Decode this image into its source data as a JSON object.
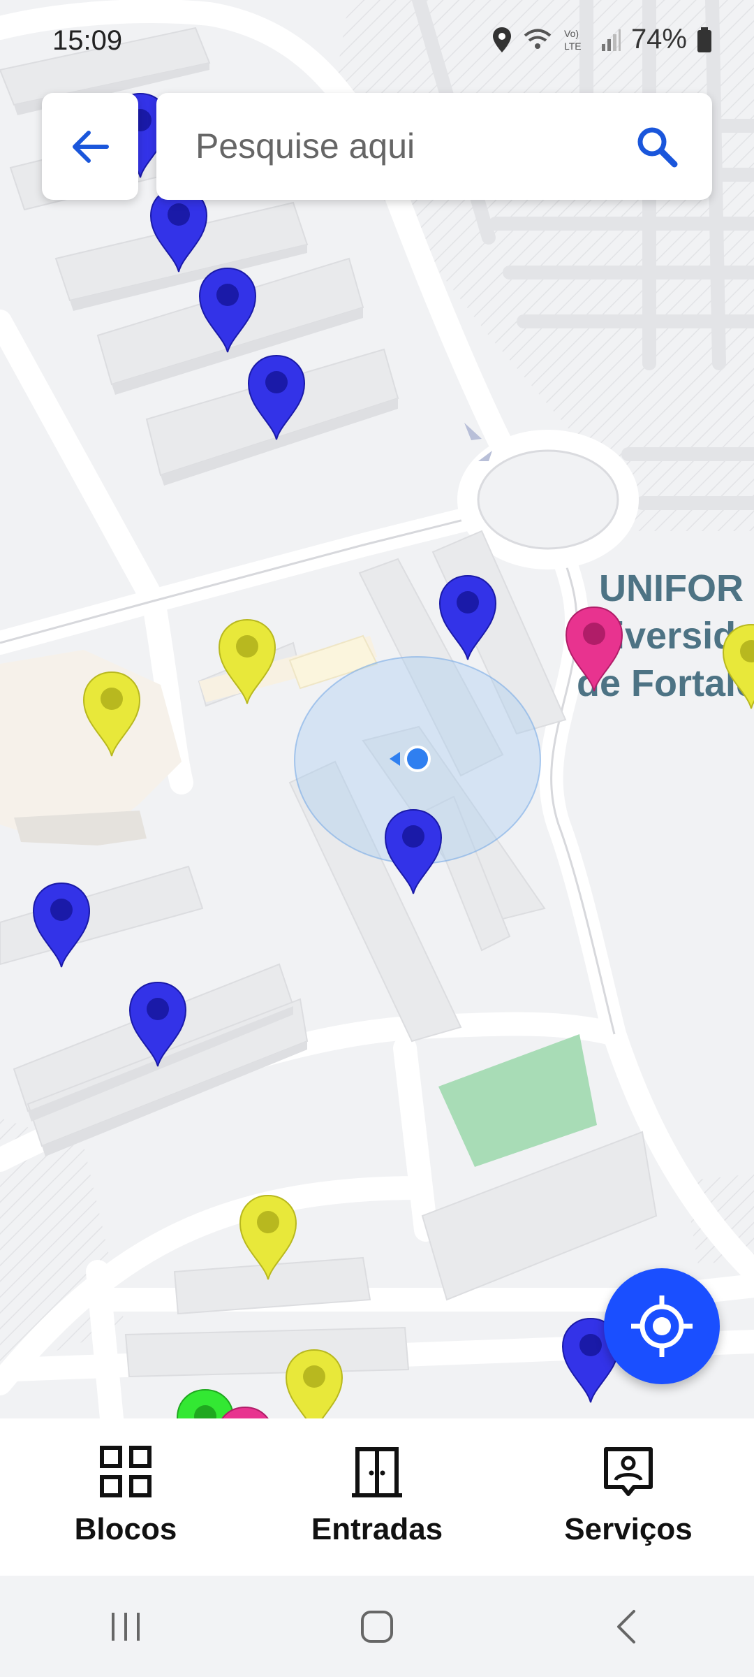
{
  "status_bar": {
    "time": "15:09",
    "battery": "74%",
    "icons": [
      "location-icon",
      "wifi-icon",
      "volte-icon",
      "signal-icon",
      "battery-icon"
    ]
  },
  "search": {
    "placeholder": "Pesquise aqui"
  },
  "map": {
    "place_label": [
      "UNIFOR -",
      "iversid",
      "de Fortale"
    ],
    "pin_colors": {
      "blue": "#3333e8",
      "yellow": "#e8e83a",
      "pink": "#e8338f",
      "green": "#33e833"
    }
  },
  "bottom_nav": {
    "items": [
      {
        "label": "Blocos",
        "icon": "grid-icon"
      },
      {
        "label": "Entradas",
        "icon": "door-icon"
      },
      {
        "label": "Serviços",
        "icon": "person-card-icon"
      }
    ]
  },
  "system_nav": [
    "recents-icon",
    "home-icon",
    "back-icon"
  ]
}
